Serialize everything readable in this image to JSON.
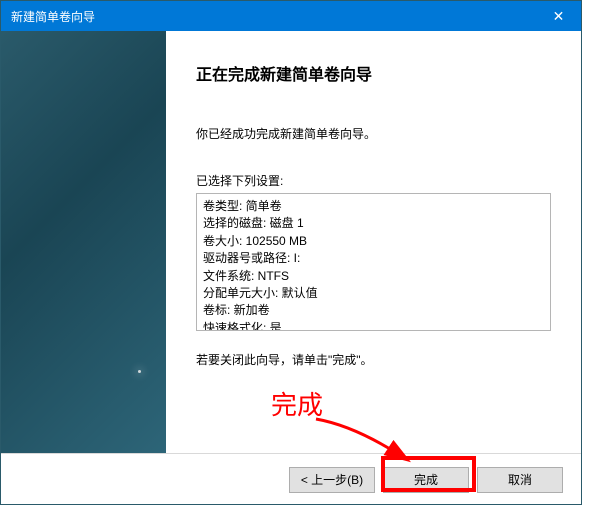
{
  "titlebar": {
    "title": "新建简单卷向导"
  },
  "wizard": {
    "heading": "正在完成新建简单卷向导",
    "message": "你已经成功完成新建简单卷向导。",
    "settings_label": "已选择下列设置:",
    "settings": [
      "卷类型: 简单卷",
      "选择的磁盘: 磁盘 1",
      "卷大小: 102550 MB",
      "驱动器号或路径: I:",
      "文件系统: NTFS",
      "分配单元大小: 默认值",
      "卷标: 新加卷",
      "快速格式化: 是"
    ],
    "closing_note": "若要关闭此向导，请单击\"完成\"。"
  },
  "buttons": {
    "back": "< 上一步(B)",
    "finish": "完成",
    "cancel": "取消"
  },
  "annotation": {
    "label": "完成"
  }
}
